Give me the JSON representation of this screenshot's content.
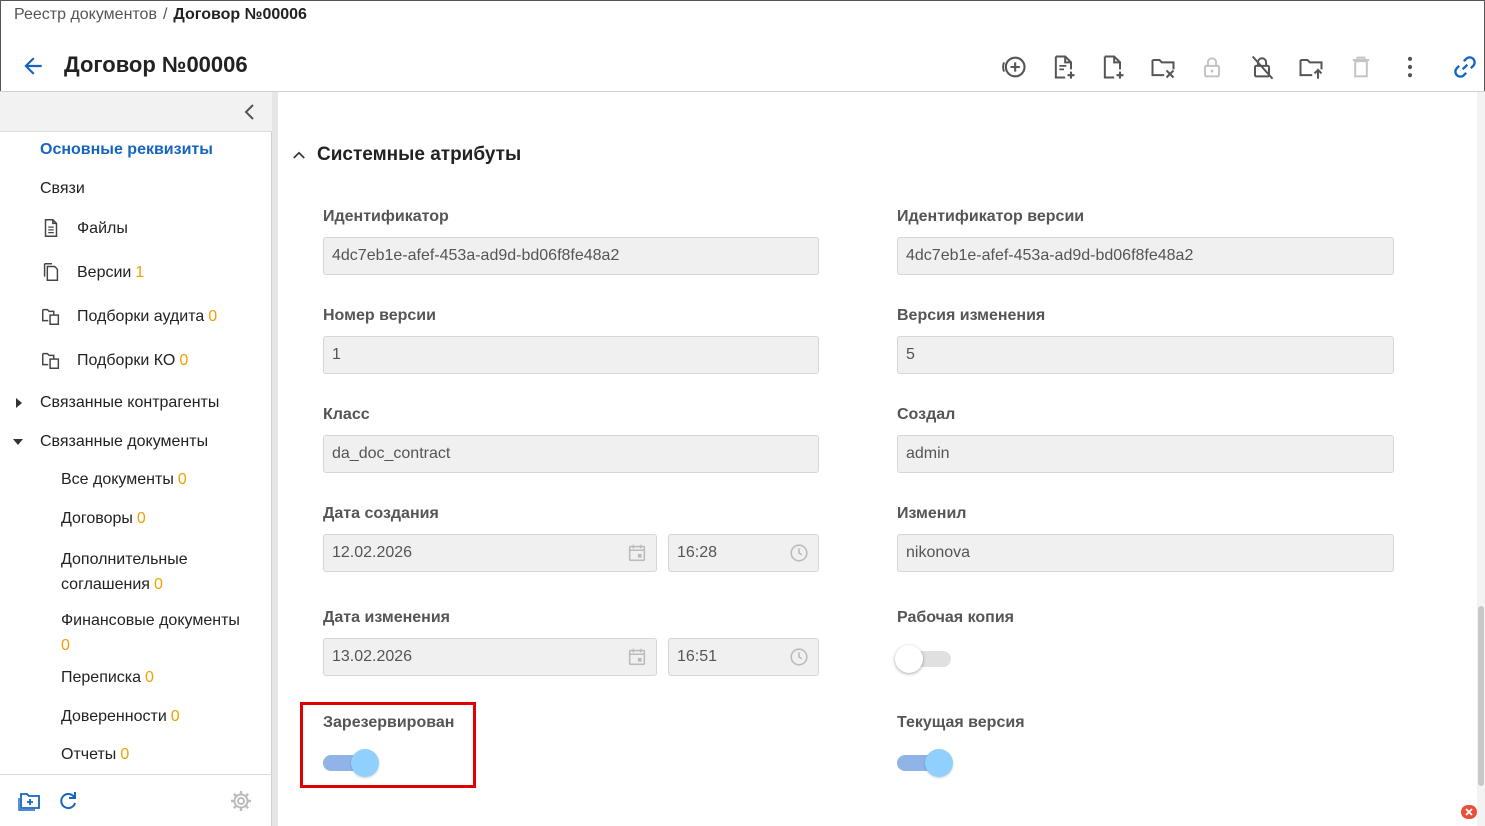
{
  "breadcrumb": {
    "root": "Реестр документов",
    "separator": "/",
    "current": "Договор №00006"
  },
  "header": {
    "title": "Договор №00006"
  },
  "sidebar": {
    "items": [
      {
        "label": "Основные реквизиты",
        "count": "",
        "active": true
      },
      {
        "label": "Связи",
        "count": ""
      },
      {
        "label": "Файлы",
        "count": "",
        "icon": "file-text-icon"
      },
      {
        "label": "Версии",
        "count": "1",
        "icon": "file-copy-icon"
      },
      {
        "label": "Подборки аудита",
        "count": "0",
        "icon": "folder-copy-icon"
      },
      {
        "label": "Подборки КО",
        "count": "0",
        "icon": "folder-copy-icon"
      },
      {
        "label": "Связанные контрагенты",
        "count": "",
        "expanded": false
      },
      {
        "label": "Связанные документы",
        "count": "",
        "expanded": true
      },
      {
        "label": "Все документы",
        "count": "0"
      },
      {
        "label": "Договоры",
        "count": "0"
      },
      {
        "label_line1": "Дополнительные",
        "label_line2": "соглашения",
        "count": "0"
      },
      {
        "label": "Финансовые документы",
        "count": "0"
      },
      {
        "label": "Переписка",
        "count": "0"
      },
      {
        "label": "Доверенности",
        "count": "0"
      },
      {
        "label": "Отчеты",
        "count": "0"
      }
    ]
  },
  "section": {
    "title": "Системные атрибуты"
  },
  "fields": {
    "id": {
      "label": "Идентификатор",
      "value": "4dc7eb1e-afef-453a-ad9d-bd06f8fe48a2"
    },
    "version_id": {
      "label": "Идентификатор версии",
      "value": "4dc7eb1e-afef-453a-ad9d-bd06f8fe48a2"
    },
    "version_number": {
      "label": "Номер версии",
      "value": "1"
    },
    "change_version": {
      "label": "Версия изменения",
      "value": "5"
    },
    "class": {
      "label": "Класс",
      "value": "da_doc_contract"
    },
    "created_by": {
      "label": "Создал",
      "value": "admin"
    },
    "created_date": {
      "label": "Дата создания",
      "date": "12.02.2026",
      "time": "16:28"
    },
    "modified_by": {
      "label": "Изменил",
      "value": "nikonova"
    },
    "modified_date": {
      "label": "Дата изменения",
      "date": "13.02.2026",
      "time": "16:51"
    },
    "working_copy": {
      "label": "Рабочая копия",
      "on": false
    },
    "reserved": {
      "label": "Зарезервирован",
      "on": true
    },
    "current_version": {
      "label": "Текущая версия",
      "on": true
    }
  },
  "colors": {
    "accent": "#1565c0",
    "count": "#f0a000",
    "highlight": "#e00000",
    "toggle_on": "#8fd0ff"
  }
}
